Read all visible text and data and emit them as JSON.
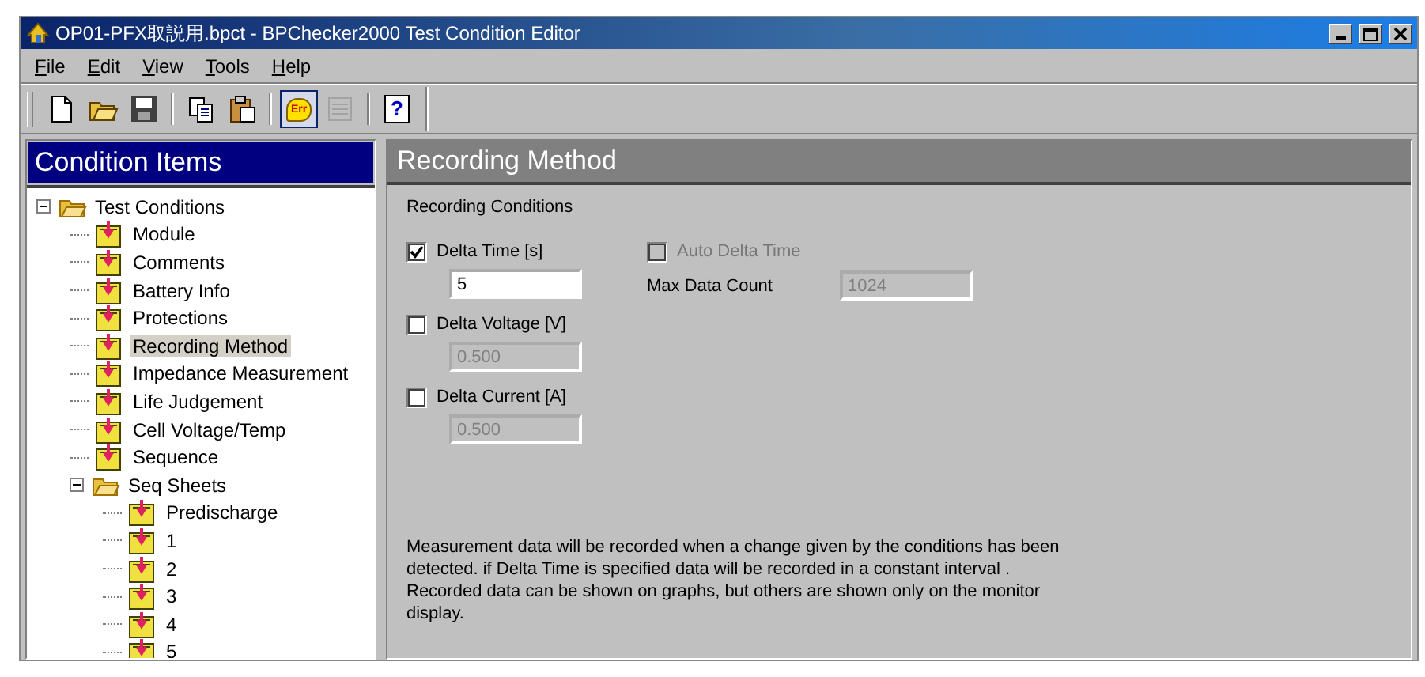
{
  "window": {
    "title": "OP01-PFX取説用.bpct - BPChecker2000 Test Condition Editor"
  },
  "menu": [
    "File",
    "Edit",
    "View",
    "Tools",
    "Help"
  ],
  "toolbar": [
    {
      "kind": "new",
      "pressed": false,
      "disabled": false
    },
    {
      "kind": "open",
      "pressed": false,
      "disabled": false
    },
    {
      "kind": "save",
      "pressed": false,
      "disabled": false
    },
    {
      "kind": "sep"
    },
    {
      "kind": "copy",
      "pressed": false,
      "disabled": false
    },
    {
      "kind": "paste",
      "pressed": false,
      "disabled": false
    },
    {
      "kind": "sep"
    },
    {
      "kind": "err",
      "label": "Err",
      "pressed": true,
      "disabled": false
    },
    {
      "kind": "allout",
      "pressed": false,
      "disabled": true
    },
    {
      "kind": "sep"
    },
    {
      "kind": "help",
      "label": "?",
      "pressed": false,
      "disabled": false
    }
  ],
  "sidebar": {
    "title": "Condition Items",
    "tree": [
      {
        "label": "Test Conditions",
        "kind": "folder",
        "expanded": true,
        "selected": false,
        "children": [
          {
            "label": "Module",
            "kind": "sheet",
            "selected": false
          },
          {
            "label": "Comments",
            "kind": "sheet",
            "selected": false
          },
          {
            "label": "Battery Info",
            "kind": "sheet",
            "selected": false
          },
          {
            "label": "Protections",
            "kind": "sheet",
            "selected": false
          },
          {
            "label": "Recording Method",
            "kind": "sheet",
            "selected": true
          },
          {
            "label": "Impedance Measurement",
            "kind": "sheet",
            "selected": false
          },
          {
            "label": "Life Judgement",
            "kind": "sheet",
            "selected": false
          },
          {
            "label": "Cell Voltage/Temp",
            "kind": "sheet",
            "selected": false
          },
          {
            "label": "Sequence",
            "kind": "sheet",
            "selected": false
          },
          {
            "label": "Seq Sheets",
            "kind": "folder",
            "expanded": true,
            "selected": false,
            "children": [
              {
                "label": "Predischarge",
                "kind": "sheet",
                "selected": false
              },
              {
                "label": "1",
                "kind": "sheet",
                "selected": false
              },
              {
                "label": "2",
                "kind": "sheet",
                "selected": false
              },
              {
                "label": "3",
                "kind": "sheet",
                "selected": false
              },
              {
                "label": "4",
                "kind": "sheet",
                "selected": false
              },
              {
                "label": "5",
                "kind": "sheet",
                "selected": false
              }
            ]
          }
        ]
      }
    ]
  },
  "panel": {
    "title": "Recording Method",
    "section": "Recording Conditions",
    "conditions": [
      {
        "label": "Delta Time [s]",
        "checked": true,
        "value": "5",
        "disabled": false
      },
      {
        "label": "Delta Voltage [V]",
        "checked": false,
        "value": "0.500",
        "disabled": true
      },
      {
        "label": "Delta Current [A]",
        "checked": false,
        "value": "0.500",
        "disabled": true
      }
    ],
    "auto_delta": {
      "label": "Auto Delta Time",
      "checked": false,
      "disabled": true
    },
    "max_count": {
      "label": "Max Data Count",
      "value": "1024",
      "disabled": true
    },
    "note": [
      "Measurement data will be recorded when a change given by the conditions has been detected.  if Delta Time is specified data will be recorded in a constant interval  .",
      "Recorded data can be shown on graphs, but others are shown only on the monitor display."
    ]
  }
}
